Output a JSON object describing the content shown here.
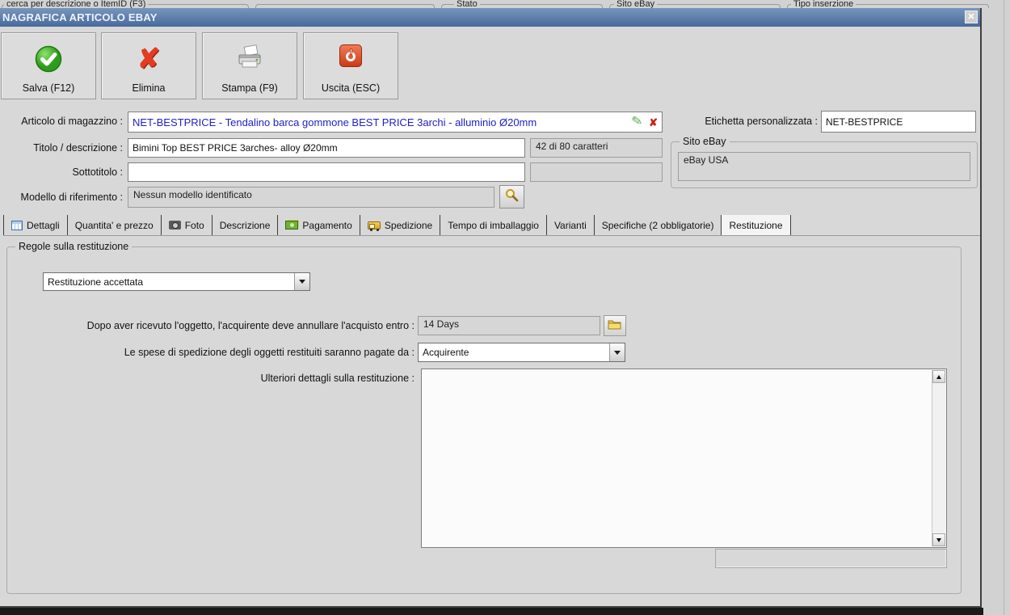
{
  "background_window": {
    "group_labels": [
      "cerca per descrizione o ItemID (F3)",
      "Stato",
      "Sito eBay",
      "Tipo inserzione"
    ]
  },
  "dialog": {
    "title": "NAGRAFICA ARTICOLO EBAY",
    "close_glyph": "✕",
    "toolbar": [
      {
        "label": "Salva (F12)",
        "icon": "check-circle"
      },
      {
        "label": "Elimina",
        "icon": "red-x"
      },
      {
        "label": "Stampa (F9)",
        "icon": "printer"
      },
      {
        "label": "Uscita (ESC)",
        "icon": "power"
      }
    ],
    "fields": {
      "articolo_label": "Articolo di magazzino :",
      "articolo_value": "NET-BESTPRICE - Tendalino barca gommone BEST PRICE 3archi - alluminio Ø20mm",
      "titolo_label": "Titolo / descrizione :",
      "titolo_value": "Bimini Top BEST PRICE 3arches- alloy Ø20mm",
      "titolo_counter": "42 di 80 caratteri",
      "sottotitolo_label": "Sottotitolo :",
      "sottotitolo_value": "",
      "sottotitolo_counter": "",
      "modello_label": "Modello di riferimento :",
      "modello_value": "Nessun modello identificato",
      "etichetta_label": "Etichetta personalizzata :",
      "etichetta_value": "NET-BESTPRICE",
      "sito_ebay_legend": "Sito eBay",
      "sito_ebay_value": "eBay USA"
    },
    "tabs": [
      {
        "label": "Dettagli",
        "icon": "table-icon",
        "active": false
      },
      {
        "label": "Quantita' e prezzo",
        "icon": null,
        "active": false
      },
      {
        "label": "Foto",
        "icon": "camera-icon",
        "active": false
      },
      {
        "label": "Descrizione",
        "icon": null,
        "active": false
      },
      {
        "label": "Pagamento",
        "icon": "money-icon",
        "active": false
      },
      {
        "label": "Spedizione",
        "icon": "truck-icon",
        "active": false
      },
      {
        "label": "Tempo di imballaggio",
        "icon": null,
        "active": false
      },
      {
        "label": "Varianti",
        "icon": null,
        "active": false
      },
      {
        "label": "Specifiche (2 obbligatorie)",
        "icon": null,
        "active": false
      },
      {
        "label": "Restituzione",
        "icon": null,
        "active": true
      }
    ],
    "restituzione": {
      "group_legend": "Regole sulla restituzione",
      "policy_value": "Restituzione accettata",
      "within_label": "Dopo aver ricevuto l'oggetto, l'acquirente deve annullare l'acquisto entro :",
      "within_value": "14 Days",
      "paid_by_label": "Le spese di spedizione degli oggetti restituiti saranno pagate da :",
      "paid_by_value": "Acquirente",
      "details_label": "Ulteriori dettagli sulla restituzione :",
      "details_value": "",
      "footer_value": ""
    }
  }
}
